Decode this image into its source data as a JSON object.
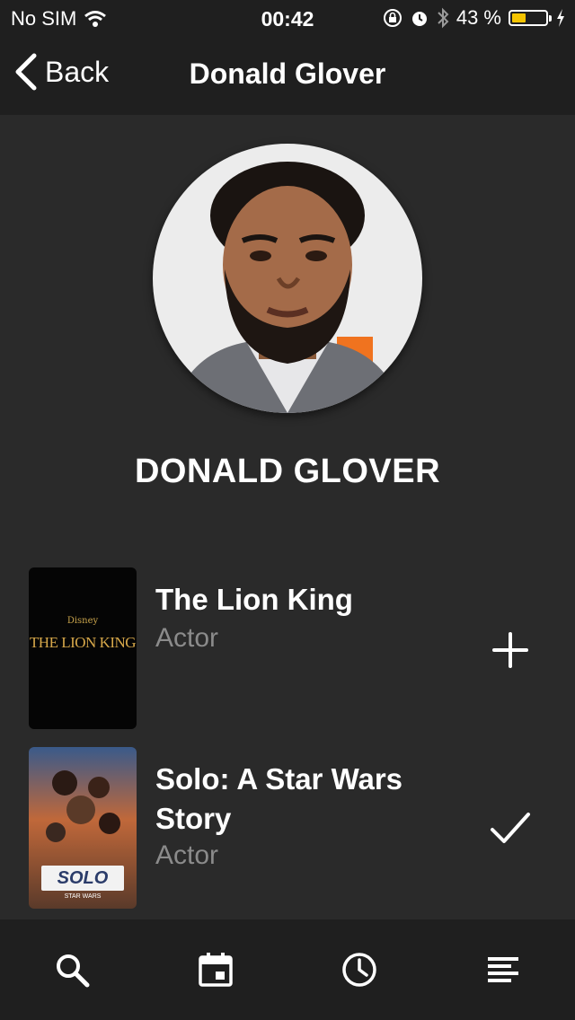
{
  "status_bar": {
    "carrier": "No SIM",
    "time": "00:42",
    "battery_text": "43 %",
    "battery_level": 0.43,
    "icons": [
      "wifi-icon",
      "orientation-lock-icon",
      "alarm-icon",
      "bluetooth-icon",
      "battery-icon",
      "charging-icon"
    ]
  },
  "nav": {
    "back_label": "Back",
    "title": "Donald Glover"
  },
  "person": {
    "name": "DONALD GLOVER",
    "photo": "portrait-photo"
  },
  "credits": [
    {
      "title": "The Lion King",
      "role": "Actor",
      "poster_text": "THE LION KING",
      "poster_brand": "Disney",
      "action_icon": "plus-icon"
    },
    {
      "title": "Solo: A Star Wars Story",
      "role": "Actor",
      "poster_text": "SOLO",
      "poster_subtext": "STAR WARS",
      "action_icon": "checkmark-icon"
    }
  ],
  "tabbar": {
    "tabs": [
      "search-icon",
      "calendar-icon",
      "clock-icon",
      "list-icon"
    ]
  },
  "colors": {
    "background": "#2a2a2a",
    "bar": "#1f1f1f",
    "secondary_text": "#8b8b8b",
    "battery_fill": "#f5c400"
  }
}
